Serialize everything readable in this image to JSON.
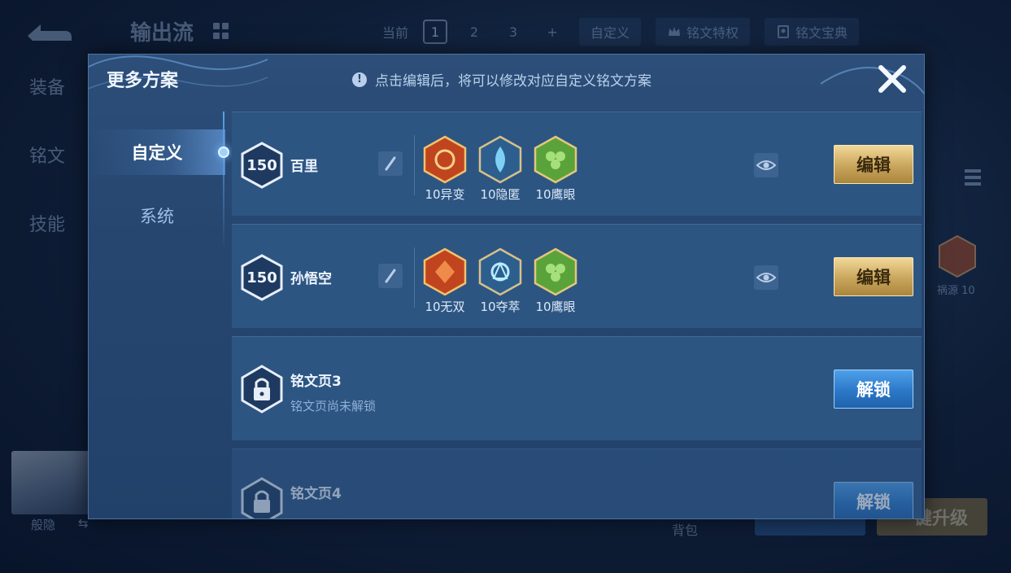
{
  "background": {
    "title": "输出流",
    "top_bar": {
      "current_label": "当前",
      "pages": [
        "1",
        "2",
        "3"
      ],
      "add_label": "+",
      "custom_label": "自定义",
      "privilege_label": "铭文特权",
      "codex_label": "铭文宝典"
    },
    "side_tabs": [
      "装备",
      "铭文",
      "技能"
    ],
    "right_rune_label": "祸源 10",
    "avatar_label": "般隐",
    "avatar_swap": "⇆",
    "bag_label": "背包",
    "upgrade_label": "一键升级"
  },
  "modal": {
    "title": "更多方案",
    "notice": "点击编辑后，将可以修改对应自定义铭文方案",
    "tabs": [
      {
        "label": "自定义",
        "active": true
      },
      {
        "label": "系统",
        "active": false
      }
    ],
    "rows": [
      {
        "level": "150",
        "name": "百里",
        "edit_label": "编辑",
        "runes": [
          {
            "label": "10异变",
            "color": "#c0451f"
          },
          {
            "label": "10隐匿",
            "color": "#4aa3d8"
          },
          {
            "label": "10鹰眼",
            "color": "#5aa33a"
          }
        ]
      },
      {
        "level": "150",
        "name": "孙悟空",
        "edit_label": "编辑",
        "runes": [
          {
            "label": "10无双",
            "color": "#c0451f"
          },
          {
            "label": "10夺萃",
            "color": "#4aa3d8"
          },
          {
            "label": "10鹰眼",
            "color": "#5aa33a"
          }
        ]
      }
    ],
    "locked_pages": [
      {
        "name": "铭文页3",
        "sub": "铭文页尚未解锁",
        "unlock_label": "解锁"
      },
      {
        "name": "铭文页4",
        "sub": "",
        "unlock_label": "解锁"
      }
    ]
  },
  "colors": {
    "accent_gold": "#c9a55c",
    "accent_blue": "#2b78c8",
    "panel": "#2d5582"
  }
}
